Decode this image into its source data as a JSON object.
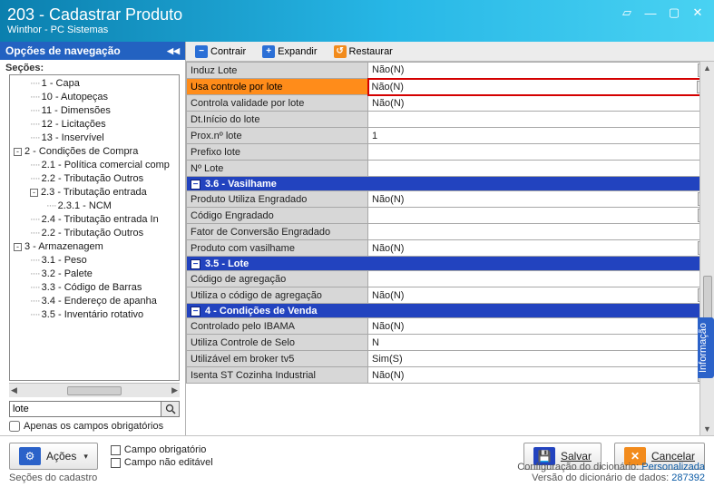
{
  "window": {
    "title": "203 - Cadastrar  Produto",
    "subtitle": "Winthor - PC Sistemas"
  },
  "nav": {
    "title": "Opções de navegação",
    "sections_label": "Seções:",
    "tree": [
      {
        "level": 1,
        "label": "1 - Capa",
        "dots": true
      },
      {
        "level": 1,
        "label": "10 - Autopeças",
        "dots": true
      },
      {
        "level": 1,
        "label": "11 - Dimensões",
        "dots": true
      },
      {
        "level": 1,
        "label": "12 - Licitações",
        "dots": true
      },
      {
        "level": 1,
        "label": "13 - Inservível",
        "dots": true
      },
      {
        "level": 0,
        "label": "2 - Condições de Compra",
        "toggle": "-"
      },
      {
        "level": 1,
        "label": "2.1 - Política comercial comp",
        "dots": true
      },
      {
        "level": 1,
        "label": "2.2 - Tributação Outros",
        "dots": true
      },
      {
        "level": 1,
        "label": "2.3 - Tributação entrada",
        "toggle": "-"
      },
      {
        "level": 2,
        "label": "2.3.1 - NCM",
        "dots": true
      },
      {
        "level": 1,
        "label": "2.4 - Tributação entrada In",
        "dots": true
      },
      {
        "level": 1,
        "label": "2.2 - Tributação Outros",
        "dots": true
      },
      {
        "level": 0,
        "label": "3 - Armazenagem",
        "toggle": "-"
      },
      {
        "level": 1,
        "label": "3.1 - Peso",
        "dots": true
      },
      {
        "level": 1,
        "label": "3.2 - Palete",
        "dots": true
      },
      {
        "level": 1,
        "label": "3.3 - Código de Barras",
        "dots": true
      },
      {
        "level": 1,
        "label": "3.4 - Endereço de apanha",
        "dots": true
      },
      {
        "level": 1,
        "label": "3.5 - Inventário rotativo",
        "dots": true
      }
    ],
    "search_value": "lote",
    "only_required_label": "Apenas os campos obrigatórios"
  },
  "toolbar": {
    "contrair": "Contrair",
    "expandir": "Expandir",
    "restaurar": "Restaurar"
  },
  "grid": {
    "rows_top": [
      {
        "label": "Induz Lote",
        "value": "Não(N)",
        "combo": true
      },
      {
        "label": "Usa controle por lote",
        "value": "Não(N)",
        "highlight": true,
        "selected": true,
        "combo": true
      },
      {
        "label": "Controla validade por lote",
        "value": "Não(N)"
      },
      {
        "label": "Dt.Início do lote",
        "value": ""
      },
      {
        "label": "Prox.nº lote",
        "value": "1"
      },
      {
        "label": "Prefixo lote",
        "value": ""
      },
      {
        "label": "Nº Lote",
        "value": ""
      }
    ],
    "section1": "3.6 - Vasilhame",
    "rows_s1": [
      {
        "label": "Produto Utiliza Engradado",
        "value": "Não(N)",
        "combo": true
      },
      {
        "label": "Código Engradado",
        "value": "",
        "combo": true
      },
      {
        "label": "Fator de Conversão Engradado",
        "value": ""
      },
      {
        "label": "Produto com vasilhame",
        "value": "Não(N)",
        "combo": true
      }
    ],
    "section2": "3.5 - Lote",
    "rows_s2": [
      {
        "label": "Código de agregação",
        "value": ""
      },
      {
        "label": "Utiliza o código de agregação",
        "value": "Não(N)",
        "combo": true
      }
    ],
    "section3": "4 - Condições de Venda",
    "rows_s3": [
      {
        "label": "Controlado pelo IBAMA",
        "value": "Não(N)",
        "combo": true
      },
      {
        "label": "Utiliza Controle de Selo",
        "value": "N"
      },
      {
        "label": "Utilizável em broker tv5",
        "value": "Sim(S)",
        "combo": true
      },
      {
        "label": "Isenta ST Cozinha Industrial",
        "value": "Não(N)",
        "combo": true
      }
    ]
  },
  "info_tab": "Informação",
  "footer": {
    "acoes": "Ações",
    "legend_required": "Campo obrigatório",
    "legend_readonly": "Campo não editável",
    "salvar": "Salvar",
    "cancelar": "Cancelar"
  },
  "status": {
    "left": "Seções do cadastro",
    "cfg_label": "Configuração do dicionário:",
    "cfg_value": "Personalizada",
    "ver_label": "Versão do dicionário de dados:",
    "ver_value": "287392"
  }
}
